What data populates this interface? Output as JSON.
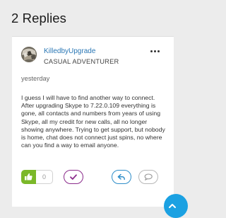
{
  "thread": {
    "replies_heading": "2 Replies"
  },
  "post": {
    "author": {
      "name": "KilledbyUpgrade",
      "rank": "CASUAL ADVENTURER"
    },
    "date": "yesterday",
    "body": "I guess I will have to find another way to connect. After upgrading Skype to 7.22.0.109 everything is gone, all contacts and numbers from years of using Skype, all my credit for new calls, all no longer showing anywhere. Trying to get support, but nobody is home, chat does not connect just spins, no where can you find a way to email anyone.",
    "like_count": "0"
  },
  "icons": {
    "more": "more-horizontal-icon",
    "like": "thumbs-up-icon",
    "solution": "checkmark-icon",
    "reply": "reply-arrow-icon",
    "comment": "speech-bubble-icon",
    "scroll_top": "chevron-up-icon"
  },
  "colors": {
    "link": "#2a77b5",
    "like_green": "#7bb829",
    "solution_purple": "#8b2c8c",
    "reply_blue": "#2f8ec9",
    "fab_blue": "#1ba1e2"
  }
}
